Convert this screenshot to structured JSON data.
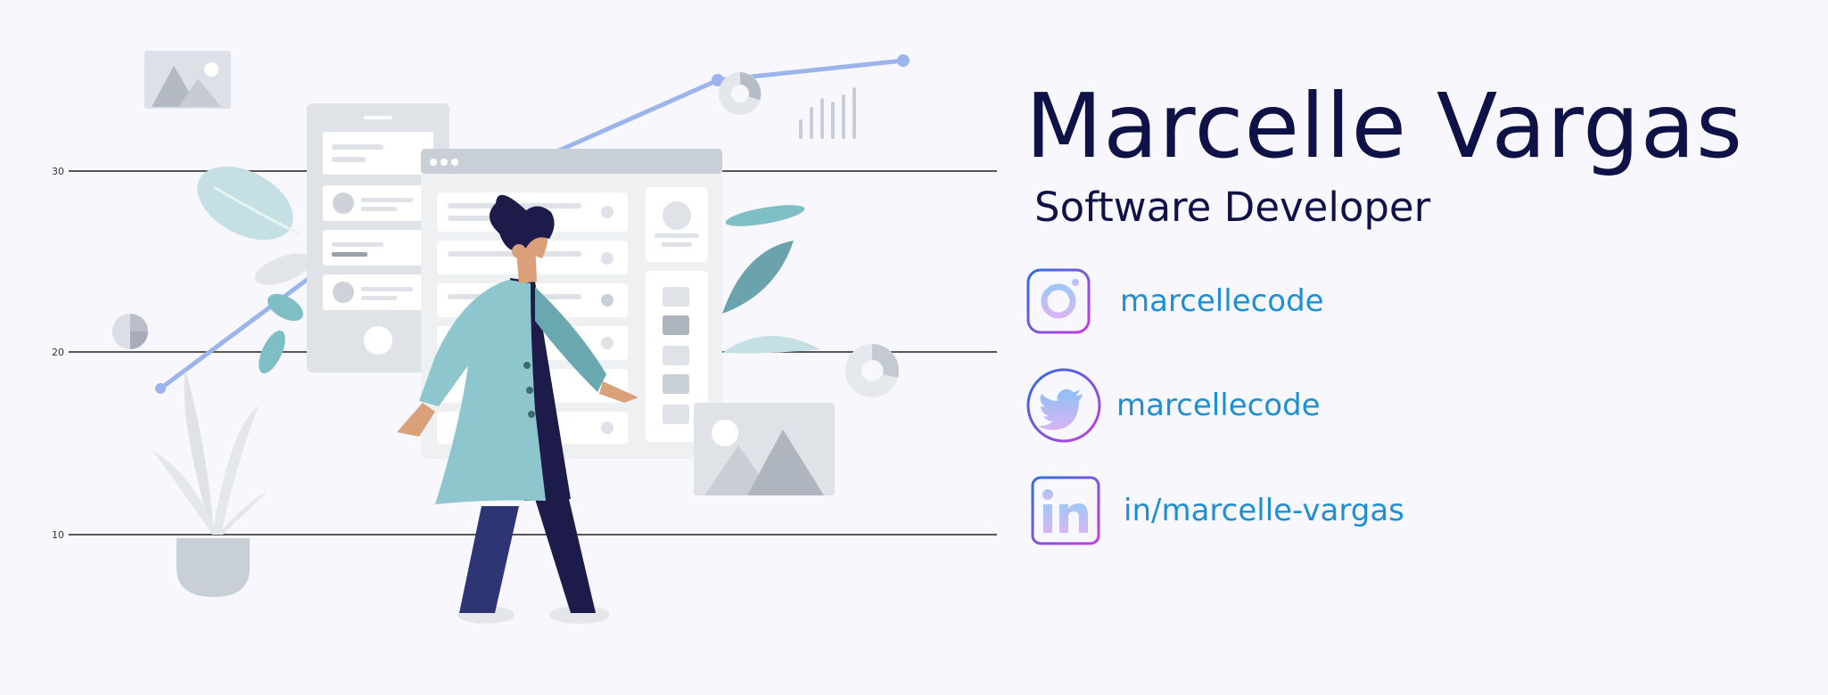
{
  "profile": {
    "name": "Marcelle Vargas",
    "title": "Software Developer"
  },
  "social": {
    "instagram": {
      "handle": "marcellecode",
      "icon": "instagram-icon"
    },
    "twitter": {
      "handle": "marcellecode",
      "icon": "twitter-icon"
    },
    "linkedin": {
      "handle": "in/marcelle-vargas",
      "icon": "linkedin-icon"
    }
  },
  "illustration": {
    "gridlines": [
      {
        "label": "30"
      },
      {
        "label": "20"
      },
      {
        "label": "10"
      }
    ]
  },
  "colors": {
    "background": "#f8f7fd",
    "text_dark": "#0f1246",
    "link_blue": "#1d8fd2",
    "icon_gradient_start": "#2d6fe0",
    "icon_gradient_end": "#c63ce0"
  }
}
